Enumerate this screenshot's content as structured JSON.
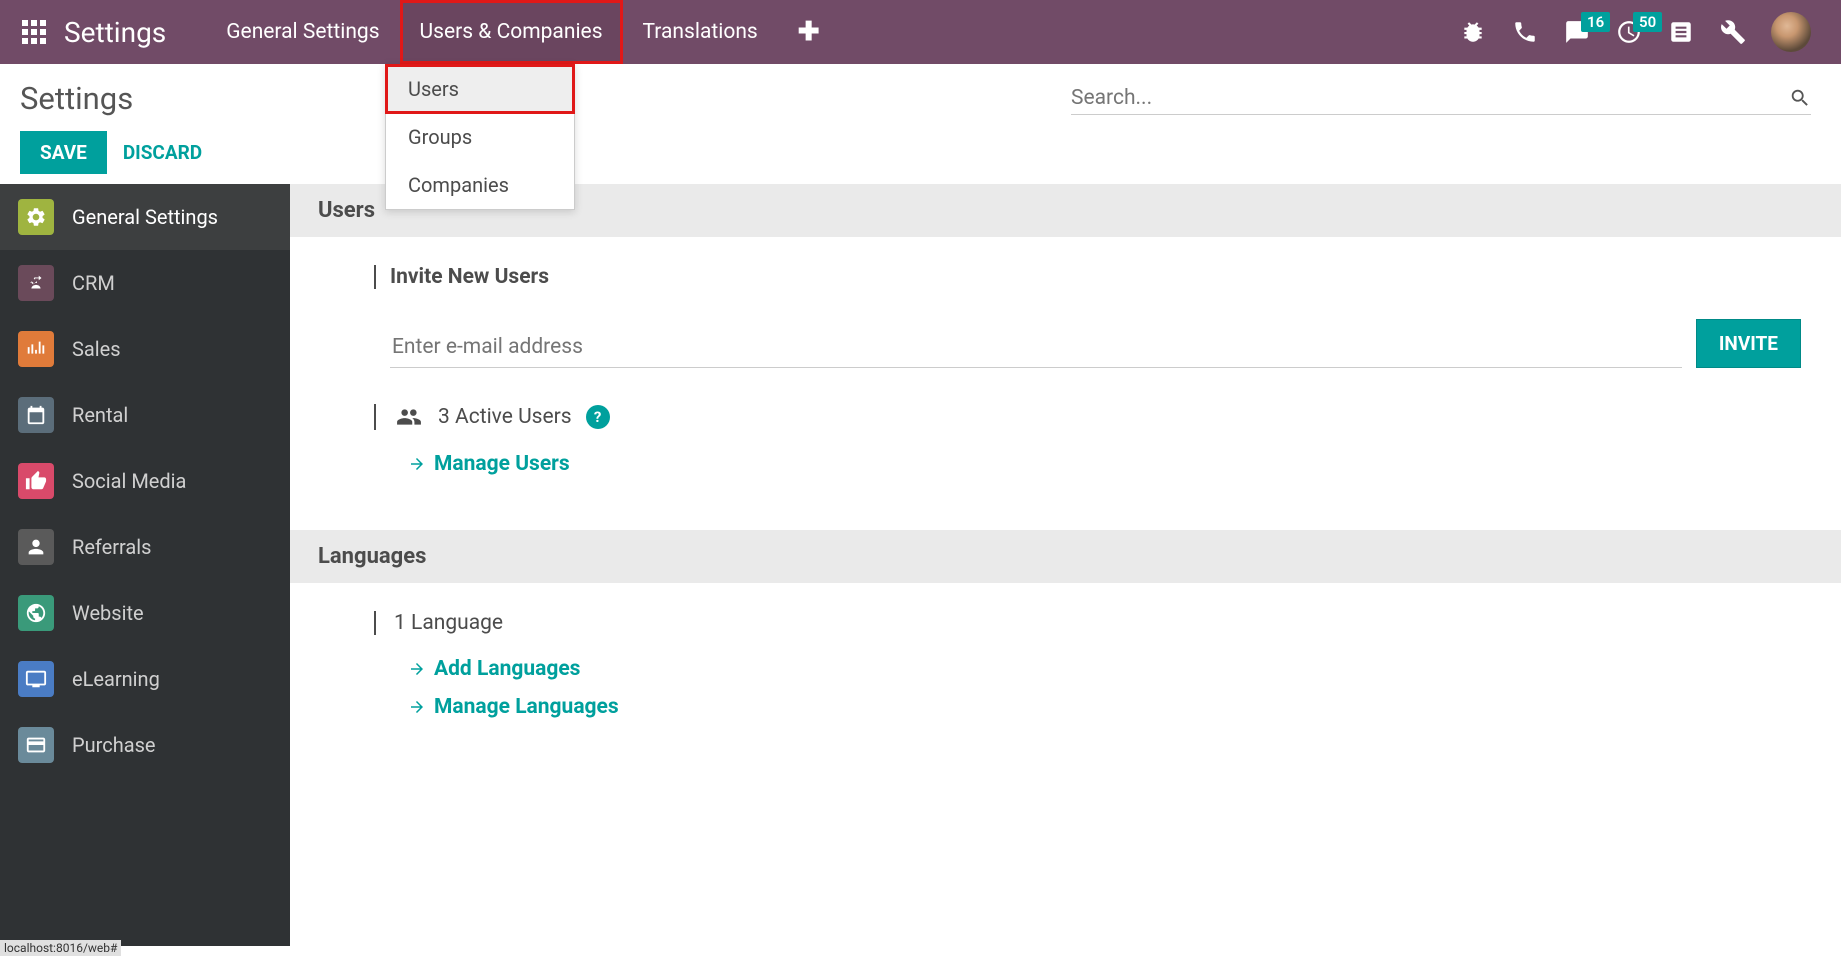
{
  "navbar": {
    "app_title": "Settings",
    "links": {
      "general": "General Settings",
      "users_companies": "Users & Companies",
      "translations": "Translations"
    },
    "badges": {
      "chat": "16",
      "activities": "50"
    }
  },
  "dropdown": {
    "users": "Users",
    "groups": "Groups",
    "companies": "Companies"
  },
  "page": {
    "title": "Settings",
    "save": "SAVE",
    "discard": "DISCARD",
    "search_placeholder": "Search..."
  },
  "sidebar": {
    "general": "General Settings",
    "crm": "CRM",
    "sales": "Sales",
    "rental": "Rental",
    "social": "Social Media",
    "referrals": "Referrals",
    "website": "Website",
    "elearning": "eLearning",
    "purchase": "Purchase"
  },
  "content": {
    "users_section": "Users",
    "invite_title": "Invite New Users",
    "email_placeholder": "Enter e-mail address",
    "invite_btn": "INVITE",
    "active_users": "3 Active Users",
    "manage_users": "Manage Users",
    "languages_section": "Languages",
    "language_count": "1 Language",
    "add_languages": "Add Languages",
    "manage_languages": "Manage Languages"
  },
  "footer": {
    "status": "localhost:8016/web#"
  }
}
